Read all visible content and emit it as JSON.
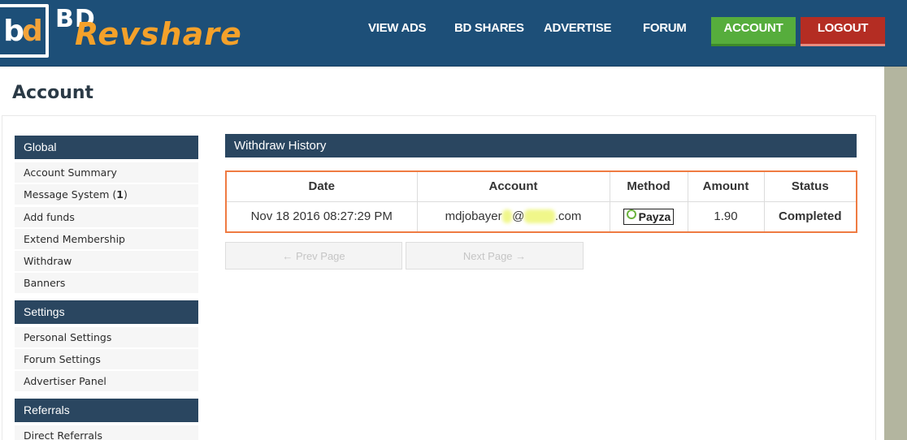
{
  "brand": {
    "mark_b": "b",
    "mark_d": "d",
    "name_top": "BD",
    "name_main": "Revshare"
  },
  "nav": {
    "items": [
      {
        "label": "VIEW ADS"
      },
      {
        "label": "BD SHARES"
      },
      {
        "label": "ADVERTISE"
      },
      {
        "label": "FORUM"
      }
    ],
    "account_label": "ACCOUNT",
    "logout_label": "LOGOUT"
  },
  "page": {
    "title": "Account"
  },
  "sidebar": {
    "sections": [
      {
        "title": "Global",
        "items": [
          {
            "label": "Account Summary"
          },
          {
            "label": "Message System (",
            "count": "1",
            "suffix": ")"
          },
          {
            "label": "Add funds"
          },
          {
            "label": "Extend Membership"
          },
          {
            "label": "Withdraw"
          },
          {
            "label": "Banners"
          }
        ]
      },
      {
        "title": "Settings",
        "items": [
          {
            "label": "Personal Settings"
          },
          {
            "label": "Forum Settings"
          },
          {
            "label": "Advertiser Panel"
          }
        ]
      },
      {
        "title": "Referrals",
        "items": [
          {
            "label": "Direct Referrals"
          }
        ]
      }
    ]
  },
  "withdraw": {
    "title": "Withdraw History",
    "columns": [
      "Date",
      "Account",
      "Method",
      "Amount",
      "Status"
    ],
    "rows": [
      {
        "date": "Nov 18 2016 08:27:29 PM",
        "account_start": "mdjobayer",
        "account_at": "@",
        "account_end": ".com",
        "method": "Payza",
        "amount": "1.90",
        "status": "Completed"
      }
    ],
    "prev_label": "← Prev Page",
    "next_label": "Next Page →"
  },
  "colors": {
    "header_bg": "#1d4f78",
    "account_btn": "#56ad3c",
    "logout_btn": "#b42d23",
    "section_head": "#2a4660",
    "table_border": "#ef7b42",
    "status_completed": "#1e7a2b",
    "logo_accent": "#f4a12a"
  },
  "icons": {
    "payza": "payza-logo-icon"
  }
}
